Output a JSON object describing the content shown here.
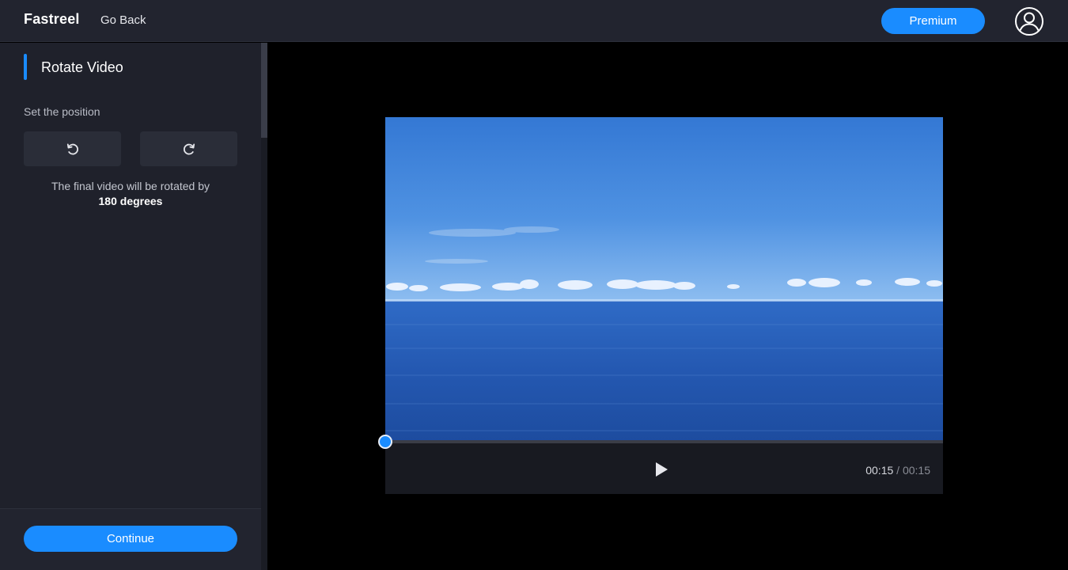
{
  "header": {
    "logo": "Fastreel",
    "go_back": "Go Back",
    "premium": "Premium",
    "icons": {
      "account": "user-circle-icon"
    }
  },
  "sidebar": {
    "section_title": "Rotate Video",
    "position_label": "Set the position",
    "rotate_buttons": [
      {
        "name": "rotate-left",
        "icon": "rotate-ccw-icon"
      },
      {
        "name": "rotate-right",
        "icon": "rotate-cw-icon"
      }
    ],
    "info_line": "The final video will be rotated by",
    "rotation_value": "180 degrees",
    "continue_label": "Continue"
  },
  "player": {
    "current_time": "00:15",
    "separator": " / ",
    "duration": "00:15",
    "progress_fraction": 0.0,
    "icons": {
      "play": "play-icon"
    }
  },
  "colors": {
    "accent": "#1a8cff",
    "sidebar_bg": "#1f212b",
    "topbar_bg": "#22242f",
    "stage_bg": "#000000"
  }
}
